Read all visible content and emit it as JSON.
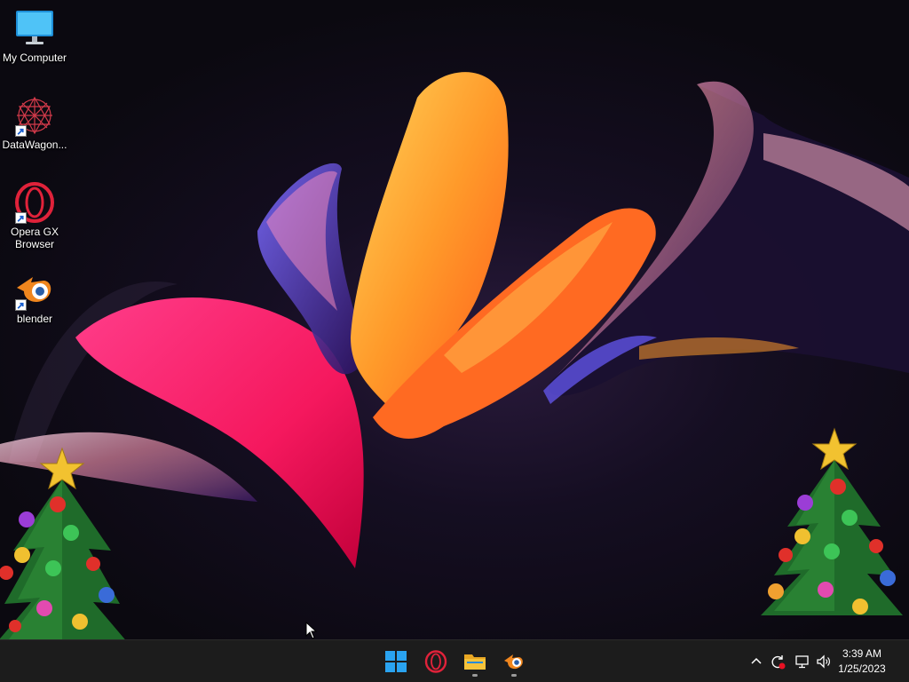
{
  "desktop": {
    "icons": [
      {
        "label": "My Computer",
        "icon": "monitor-icon",
        "shortcut": false
      },
      {
        "label": "DataWagon...",
        "icon": "datawagon-logo-icon",
        "shortcut": true
      },
      {
        "label": "Opera GX\nBrowser",
        "icon": "opera-gx-icon",
        "shortcut": true
      },
      {
        "label": "blender",
        "icon": "blender-icon",
        "shortcut": true
      }
    ],
    "wallpaper": "abstract-ribbon-wallpaper",
    "decorations": [
      "christmas-tree-icon",
      "christmas-tree-icon"
    ]
  },
  "taskbar": {
    "apps": [
      {
        "name": "start-button",
        "icon": "windows-logo-icon",
        "running": false
      },
      {
        "name": "opera-gx",
        "icon": "opera-gx-icon",
        "running": false
      },
      {
        "name": "file-explorer",
        "icon": "folder-icon",
        "running": true
      },
      {
        "name": "blender",
        "icon": "blender-icon",
        "running": true
      }
    ],
    "tray": {
      "icons": [
        "chevron-up-icon",
        "sync-icon",
        "network-icon",
        "speaker-icon"
      ],
      "time": "3:39 AM",
      "date": "1/25/2023"
    }
  },
  "colors": {
    "taskbar_bg": "#1c1c1c",
    "windows_blue": "#2aa3f0",
    "opera_red": "#e0223a",
    "blender_orange": "#f0861e",
    "folder_yellow": "#f6c33a"
  }
}
